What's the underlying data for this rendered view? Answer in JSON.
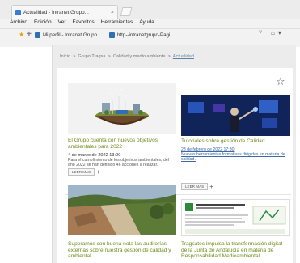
{
  "browser": {
    "tab_title": "Actualidad - Intranet Grupo...",
    "tab_close": "×",
    "menu": [
      "Archivo",
      "Edición",
      "Ver",
      "Favoritos",
      "Herramientas",
      "Ayuda"
    ],
    "favorites": [
      {
        "label": "Mi perfil - Intranet Grupo ..."
      },
      {
        "label": "http--intranetgrupo-Pagi..."
      }
    ]
  },
  "breadcrumb": [
    "Inicio",
    ">",
    "Grupo Tragsa",
    ">",
    "Calidad y medio ambiente",
    ">",
    "Actualidad"
  ],
  "news": [
    {
      "title": "El Grupo cuenta con nuevos objetivos ambientales para 2022",
      "date": "4 de marzo de 2022 13:00",
      "text": "Para el cumplimiento de los objetivos ambientales, del año 2022 se han definido 46 acciones a realizar.",
      "button": "LEER MÁS"
    },
    {
      "title": "Tutoriales sobre gestión de Calidad",
      "date": "23 de febrero de 2022 17:30",
      "text": "Nuevas herramientas formativas dirigidas en materia de calidad.",
      "button": "LEER MÁS"
    },
    {
      "title": "Superamos con buena nota las auditorías externas sobre nuestra gestión de calidad y ambiental",
      "date": "",
      "text": "",
      "button": ""
    },
    {
      "title": "Tragsatec impulsa la transformación digital de la Junta de Andalucía en materia de Responsabilidad Medioambiental",
      "date": "",
      "text": "",
      "button": ""
    }
  ],
  "colors": {
    "title_green": "#6c8c1a",
    "link_blue": "#3b6aa5",
    "frame_grey": "#ececec"
  },
  "icons": {
    "page_star": "☆",
    "plus": "+",
    "chevron": "˅",
    "home": "⌂"
  }
}
